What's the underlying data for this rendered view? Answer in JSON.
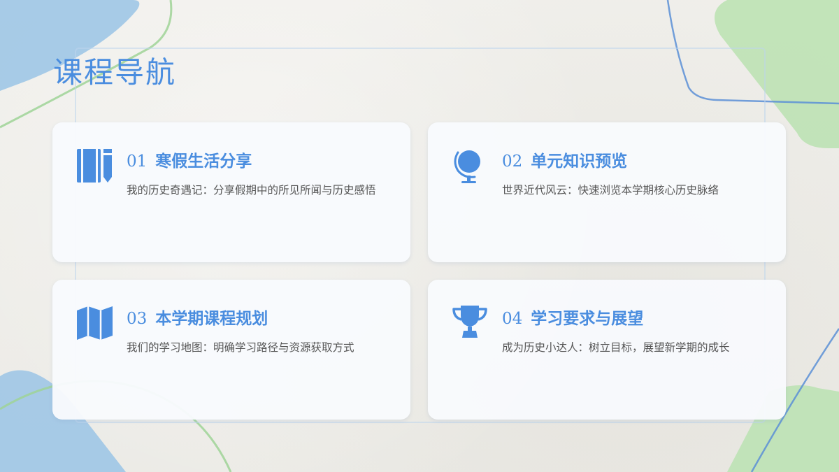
{
  "page": {
    "title": "课程导航"
  },
  "colors": {
    "accent": "#4a8ddf",
    "text": "#555555",
    "card_bg": "#f8fafd",
    "deco_blue": "#9fc6e6",
    "deco_green": "#bfe3b6",
    "deco_line_blue": "#5b8fd6",
    "deco_line_green": "#8fcf86",
    "background": "#efeeea"
  },
  "cards": [
    {
      "number": "01",
      "title": "寒假生活分享",
      "description": "我的历史奇遇记：分享假期中的所见所闻与历史感悟",
      "icon": "book-pencil-icon"
    },
    {
      "number": "02",
      "title": "单元知识预览",
      "description": "世界近代风云：快速浏览本学期核心历史脉络",
      "icon": "globe-icon"
    },
    {
      "number": "03",
      "title": "本学期课程规划",
      "description": "我们的学习地图：明确学习路径与资源获取方式",
      "icon": "map-icon"
    },
    {
      "number": "04",
      "title": "学习要求与展望",
      "description": "成为历史小达人：树立目标，展望新学期的成长",
      "icon": "trophy-icon"
    }
  ]
}
